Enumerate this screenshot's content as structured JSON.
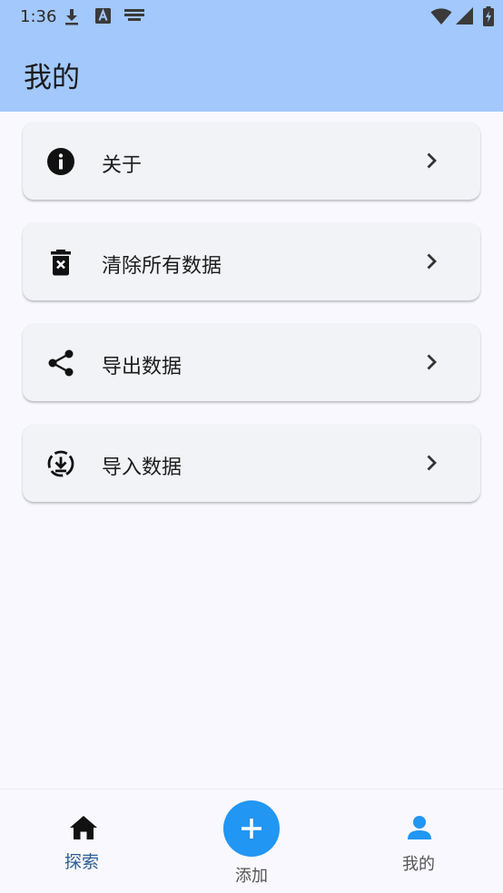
{
  "status_bar": {
    "time": "1:36",
    "left_icons": [
      "download-icon",
      "text-a-icon",
      "keyboard-icon"
    ],
    "right_icons": [
      "wifi-icon",
      "signal-icon",
      "battery-charging-icon"
    ]
  },
  "header": {
    "title": "我的",
    "background": "#a3c8fc"
  },
  "menu": {
    "items": [
      {
        "label": "关于",
        "icon": "info-icon"
      },
      {
        "label": "清除所有数据",
        "icon": "delete-icon"
      },
      {
        "label": "导出数据",
        "icon": "share-icon"
      },
      {
        "label": "导入数据",
        "icon": "download-circle-icon"
      }
    ]
  },
  "bottom_nav": {
    "explore_label": "探索",
    "add_label": "添加",
    "mine_label": "我的",
    "active_color": "#2b5d92",
    "fab_color": "#2196f3",
    "profile_color": "#2196f3"
  }
}
